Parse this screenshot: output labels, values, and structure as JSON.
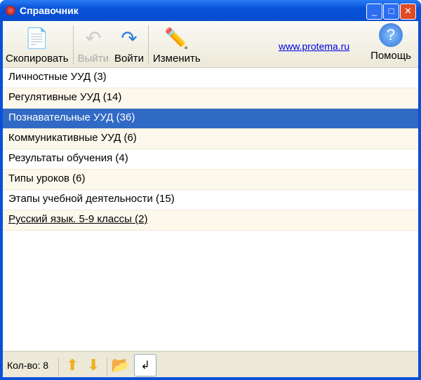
{
  "window": {
    "title": "Справочник"
  },
  "toolbar": {
    "copy": "Скопировать",
    "exit": "Выйти",
    "enter": "Войти",
    "edit": "Изменить",
    "link": "www.protema.ru",
    "help": "Помощь"
  },
  "list": [
    "Личностные УУД (3)",
    "Регулятивные УУД (14)",
    "Познавательные УУД (36)",
    "Коммуникативные УУД (6)",
    "Результаты обучения (4)",
    "Типы уроков (6)",
    "Этапы учебной деятельности (15)",
    "Русский язык. 5-9 классы (2)"
  ],
  "selected_index": 2,
  "status": {
    "count": "Кол-во: 8"
  }
}
